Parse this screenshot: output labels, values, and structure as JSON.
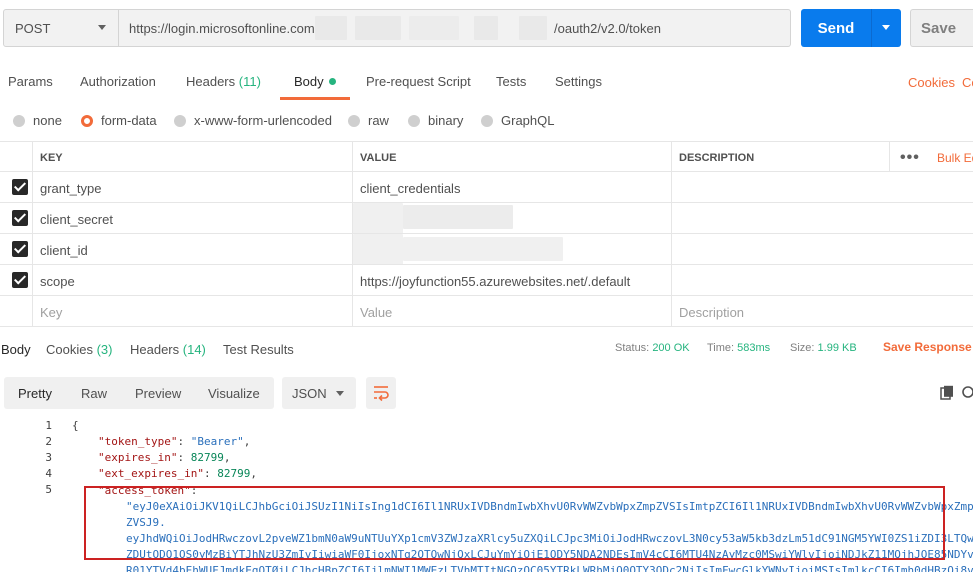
{
  "request": {
    "method": "POST",
    "url_start": "https://login.microsoftonline.com",
    "url_end": "/oauth2/v2.0/token",
    "send_label": "Send",
    "save_label": "Save"
  },
  "request_tabs": {
    "params": "Params",
    "authorization": "Authorization",
    "headers": "Headers",
    "headers_count": "(11)",
    "body": "Body",
    "prerequest": "Pre-request Script",
    "tests": "Tests",
    "settings": "Settings",
    "cookies": "Cookies",
    "code": "Co"
  },
  "body_types": {
    "none": "none",
    "form_data": "form-data",
    "urlencoded": "x-www-form-urlencoded",
    "raw": "raw",
    "binary": "binary",
    "graphql": "GraphQL",
    "selected": "form-data"
  },
  "params_table": {
    "headers": {
      "key": "KEY",
      "value": "VALUE",
      "description": "DESCRIPTION",
      "bulk_edit": "Bulk Ed"
    },
    "rows": [
      {
        "key": "grant_type",
        "value": "client_credentials",
        "checked": true
      },
      {
        "key": "client_secret",
        "value": "",
        "checked": true
      },
      {
        "key": "client_id",
        "value": "",
        "checked": true
      },
      {
        "key": "scope",
        "value": "https://joyfunction55.azurewebsites.net/.default",
        "checked": true
      }
    ],
    "placeholders": {
      "key": "Key",
      "value": "Value",
      "description": "Description"
    }
  },
  "response_tabs": {
    "body": "Body",
    "cookies": "Cookies",
    "cookies_count": "(3)",
    "headers": "Headers",
    "headers_count": "(14)",
    "test_results": "Test Results"
  },
  "response_status": {
    "status_label": "Status:",
    "status_value": "200 OK",
    "time_label": "Time:",
    "time_value": "583ms",
    "size_label": "Size:",
    "size_value": "1.99 KB",
    "save_response": "Save Response"
  },
  "format_bar": {
    "pretty": "Pretty",
    "raw": "Raw",
    "preview": "Preview",
    "visualize": "Visualize",
    "language": "JSON"
  },
  "code": {
    "line_numbers": [
      "1",
      "2",
      "3",
      "4",
      "5"
    ],
    "open_brace": "{",
    "token_type_key": "\"token_type\"",
    "token_type_value": "\"Bearer\"",
    "expires_in_key": "\"expires_in\"",
    "expires_in_value": "82799",
    "ext_expires_in_key": "\"ext_expires_in\"",
    "ext_expires_in_value": "82799",
    "access_token_key": "\"access_token\"",
    "token_lines": [
      "\"eyJ0eXAiOiJKV1QiLCJhbGciOiJSUzI1NiIsIng1dCI6Il1NRUxIVDBndmIwbXhvU0RvWWZvbWpxZmpZVSIsImtpZCI6Il1NRUxIVDBndmIwbXhvU0RvWWZvbWpxZmp",
      "ZVSJ9.",
      "eyJhdWQiOiJodHRwczovL2pveWZ1bmN0aW9uNTUuYXp1cmV3ZWJzaXRlcy5uZXQiLCJpc3MiOiJodHRwczovL3N0cy53aW5kb3dzLm51dC91NGM5YWI0ZS1iZDI3LTQw",
      "ZDUtODQ1OS0yMzBiYTJhNzU3ZmIvIiwiaWF0IjoxNTg2OTQwNjQxLCJuYmYiOjE1ODY5NDA2NDEsImV4cCI6MTU4NzAyMzc0MSwiYWlvIjoiNDJkZ11MQjhJOE85NDYv",
      "R01YTVd4bEhWUFJmdkEgOTØiLCJhcHBpZCI6IjlmNWI1MWEzLTVhMTItNGQzOC05YTRkLWRhMjQ0OTY3ODc2NiIsImFwcGlkYWNyIjoiMSIsImlkcCI6Imh0dHBzOi8v"
    ]
  }
}
